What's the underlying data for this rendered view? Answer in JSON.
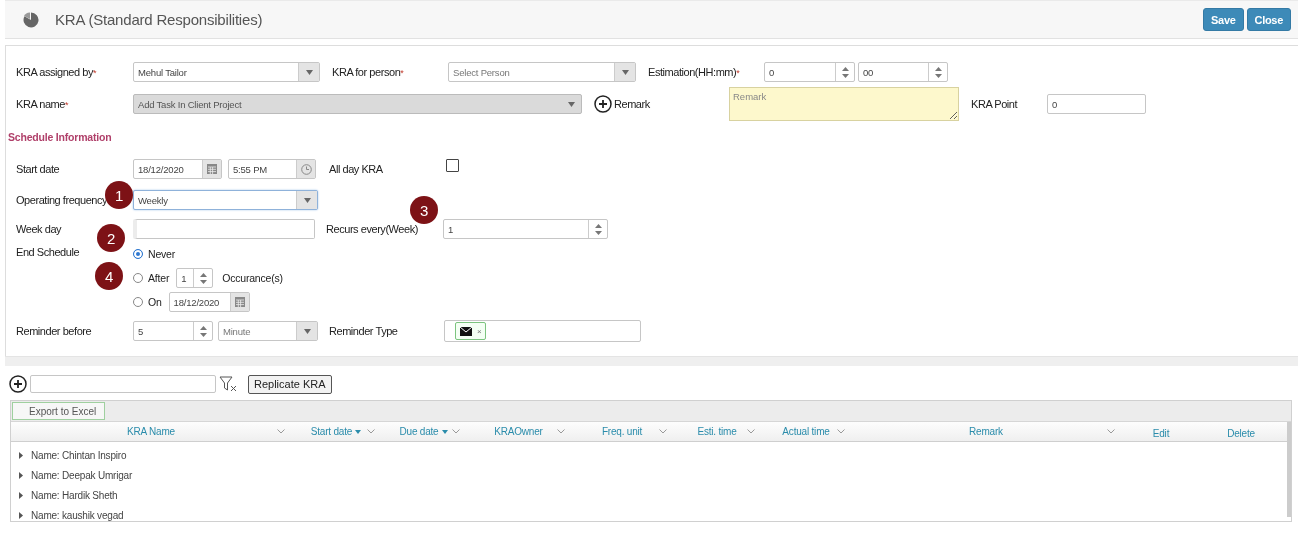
{
  "header": {
    "title": "KRA (Standard Responsibilities)",
    "buttons": [
      "Save",
      "Close"
    ]
  },
  "form": {
    "assigned_by": {
      "label": "KRA assigned by",
      "mark": "*",
      "value": "Mehul Tailor"
    },
    "for_person": {
      "label": "KRA for person",
      "mark": "*",
      "placeholder": "Select Person"
    },
    "estimation": {
      "label": "Estimation(HH:mm)",
      "mark": "*",
      "hours": "0",
      "minutes": "00"
    },
    "kra_name": {
      "label": "KRA name",
      "mark": "*",
      "value": "Add Task In Client Project",
      "disabled": true
    },
    "remark": {
      "label": "Remark",
      "placeholder": "Remark"
    },
    "kra_point": {
      "label": "KRA Point",
      "value": "0"
    }
  },
  "schedule": {
    "title": "Schedule Information",
    "start_date": {
      "label": "Start date",
      "date": "18/12/2020",
      "time": "5:55 PM"
    },
    "all_day": {
      "label": "All day KRA",
      "checked": false
    },
    "frequency": {
      "label": "Operating frequency",
      "value": "Weekly",
      "focused": true
    },
    "week_day": {
      "label": "Week day"
    },
    "recurs": {
      "label": "Recurs every(Week)",
      "value": "1"
    },
    "end_schedule": {
      "label": "End Schedule",
      "options": [
        {
          "label": "Never",
          "selected": true
        },
        {
          "label": "After",
          "selected": false,
          "value": "1",
          "suffix": "Occurance(s)"
        },
        {
          "label": "On",
          "selected": false,
          "date": "18/12/2020"
        }
      ]
    },
    "reminder": {
      "label": "Reminder before",
      "value": "5",
      "unit": "Minute"
    },
    "reminder_type": {
      "label": "Reminder Type",
      "tags": [
        {
          "kind": "email",
          "remove": "×"
        }
      ]
    }
  },
  "annotations": [
    {
      "number": "1"
    },
    {
      "number": "2"
    },
    {
      "number": "3"
    },
    {
      "number": "4"
    }
  ],
  "grid": {
    "replicate_button": "Replicate KRA",
    "export_button": "Export to Excel",
    "columns": [
      {
        "label": "KRA Name",
        "sorted": false,
        "menu": true
      },
      {
        "label": "Start date",
        "sorted": true,
        "menu": true
      },
      {
        "label": "Due date",
        "sorted": true,
        "menu": true
      },
      {
        "label": "KRAOwner",
        "sorted": false,
        "menu": true
      },
      {
        "label": "Freq. unit",
        "sorted": false,
        "menu": true
      },
      {
        "label": "Esti. time",
        "sorted": false,
        "menu": true
      },
      {
        "label": "Actual time",
        "sorted": false,
        "menu": true
      },
      {
        "label": "Remark",
        "sorted": false,
        "menu": true
      },
      {
        "label": "Edit",
        "sorted": false,
        "menu": false
      },
      {
        "label": "Delete",
        "sorted": false,
        "menu": false
      }
    ],
    "groups": [
      {
        "label": "Name: Chintan Inspiro",
        "expanded": false
      },
      {
        "label": "Name: Deepak Umrigar",
        "expanded": false
      },
      {
        "label": "Name: Hardik Sheth",
        "expanded": false
      },
      {
        "label": "Name: kaushik vegad",
        "expanded": false
      }
    ]
  }
}
